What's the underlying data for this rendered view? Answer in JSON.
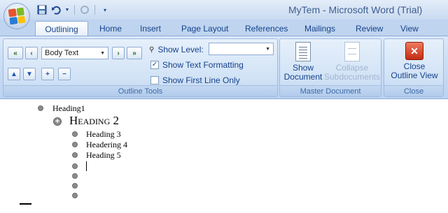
{
  "window": {
    "title": "MyTem - Microsoft Word (Trial)"
  },
  "quick_access": {
    "icons": [
      "save-icon",
      "undo-icon",
      "redo-icon",
      "customize-icon"
    ]
  },
  "tabs": [
    "Outlining",
    "Home",
    "Insert",
    "Page Layout",
    "References",
    "Mailings",
    "Review",
    "View"
  ],
  "outline_tools": {
    "level_value": "Body Text",
    "show_level_label": "Show Level:",
    "show_level_value": "",
    "show_text_formatting_label": "Show Text Formatting",
    "show_text_formatting_checked": true,
    "show_first_line_only_label": "Show First Line Only",
    "show_first_line_only_checked": false,
    "group_label": "Outline Tools"
  },
  "master_document": {
    "show_document_line1": "Show",
    "show_document_line2": "Document",
    "collapse_line1": "Collapse",
    "collapse_line2": "Subdocuments",
    "group_label": "Master Document"
  },
  "close_group": {
    "close_line1": "Close",
    "close_line2": "Outline View",
    "group_label": "Close"
  },
  "document": {
    "items": [
      {
        "text": "Heading1"
      },
      {
        "text": "Heading 2"
      },
      {
        "text": "Heading 3"
      },
      {
        "text": "Headering 4"
      },
      {
        "text": "Heading 5"
      }
    ]
  },
  "colors": {
    "ribbon_text": "#15428b",
    "close_icon": "#c32b14"
  }
}
